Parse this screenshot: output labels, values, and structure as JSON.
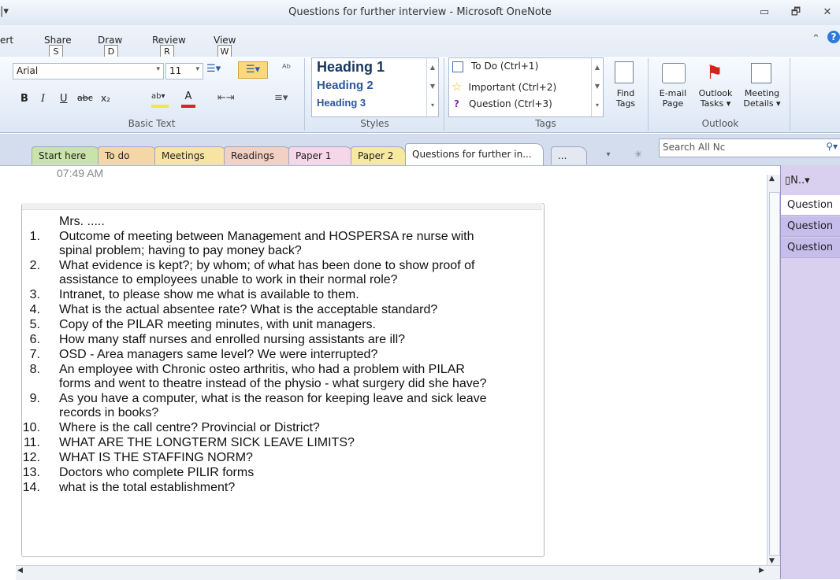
{
  "window": {
    "title": "Questions for further interview - Microsoft OneNote",
    "qat_glyph": "|▾",
    "minimize_glyph": "▭",
    "restore_glyph": "🗗",
    "close_glyph": "✕"
  },
  "menu": {
    "items": [
      "ert",
      "Share",
      "Draw",
      "Review",
      "View"
    ],
    "keytips": [
      "S",
      "D",
      "R",
      "W"
    ],
    "help_glyph": "?",
    "collapse_glyph": "⌃"
  },
  "ribbon": {
    "font_name": "Arial",
    "font_size": "11",
    "format_buttons": [
      "B",
      "I",
      "U",
      "abc",
      "x₂"
    ],
    "group_basic_text": "Basic Text",
    "styles": [
      "Heading 1",
      "Heading 2",
      "Heading 3"
    ],
    "group_styles": "Styles",
    "tags": [
      "To Do (Ctrl+1)",
      "Important (Ctrl+2)",
      "Question (Ctrl+3)"
    ],
    "find_tags": "Find Tags",
    "group_tags": "Tags",
    "email_page": "E-mail Page",
    "outlook_tasks": "Outlook Tasks ▾",
    "meeting_details": "Meeting Details ▾",
    "group_outlook": "Outlook"
  },
  "tabs": {
    "items": [
      "Start here",
      "To do",
      "Meetings",
      "Readings",
      "Paper 1",
      "Paper 2",
      "Questions for further in...",
      "..."
    ],
    "active_index": 6,
    "search_placeholder": "Search All Nc",
    "colors": [
      "#c9e3a8",
      "#f5d7a6",
      "#f7e4a3",
      "#f2d0c3",
      "#f6d7ea",
      "#f7e9a0",
      "#ffffff",
      "#e3e8f1"
    ]
  },
  "page": {
    "time": "07:49 AM",
    "header": "Mrs. .....",
    "questions": [
      {
        "num": "1.",
        "lines": [
          "Outcome of meeting between Management and HOSPERSA re nurse with",
          "spinal problem; having to pay money back?"
        ]
      },
      {
        "num": "2.",
        "lines": [
          "What evidence is kept?; by whom; of what has been done to show proof of",
          "assistance to employees unable to work in their normal role?"
        ]
      },
      {
        "num": "3.",
        "lines": [
          "Intranet, to please show me what is available to them."
        ]
      },
      {
        "num": "4.",
        "lines": [
          "What is the actual absentee rate? What is the acceptable standard?"
        ]
      },
      {
        "num": "5.",
        "lines": [
          "Copy of the PILAR meeting minutes, with unit managers."
        ]
      },
      {
        "num": "6.",
        "lines": [
          "How many staff nurses and enrolled nursing assistants are ill?"
        ]
      },
      {
        "num": "7.",
        "lines": [
          "OSD - Area managers same level? We were interrupted?"
        ]
      },
      {
        "num": "8.",
        "lines": [
          "An employee with Chronic osteo arthritis, who had a problem with PILAR",
          "forms and went to theatre instead of the physio - what surgery did she have?"
        ]
      },
      {
        "num": "9.",
        "lines": [
          "As you have a computer, what is the reason for keeping leave and sick leave",
          "records in books?"
        ]
      },
      {
        "num": "10.",
        "lines": [
          "Where is the call centre? Provincial or District?"
        ]
      },
      {
        "num": "11.",
        "lines": [
          "WHAT ARE THE LONGTERM SICK LEAVE LIMITS?"
        ]
      },
      {
        "num": "12.",
        "lines": [
          "WHAT IS THE STAFFING NORM?"
        ]
      },
      {
        "num": "13.",
        "lines": [
          "Doctors who complete PILIR forms"
        ]
      },
      {
        "num": "14.",
        "lines": [
          "what is the total establishment?"
        ]
      }
    ]
  },
  "pages_panel": {
    "new_page_label": "N..",
    "items": [
      "Question",
      "Question",
      "Question"
    ]
  }
}
